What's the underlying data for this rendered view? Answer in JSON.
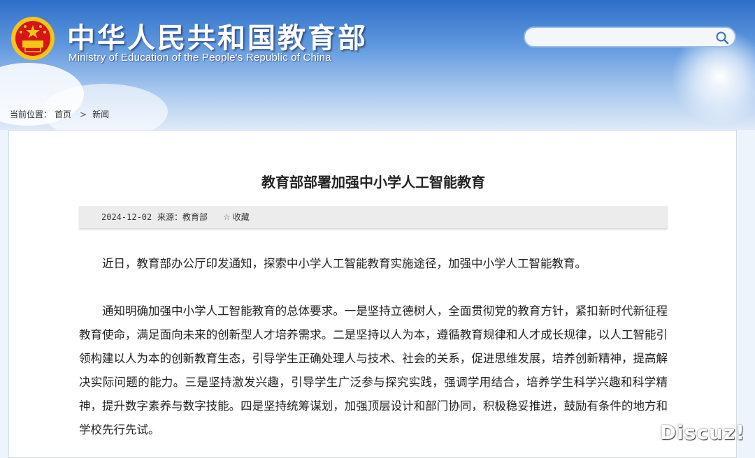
{
  "header": {
    "site_title": "中华人民共和国教育部",
    "site_subtitle": "Ministry of Education of the People's Republic of China",
    "search": {
      "value": ""
    },
    "colors": {
      "sky_top": "#2f6fc9",
      "emblem_red": "#d7141a",
      "emblem_gold": "#f5c518"
    }
  },
  "breadcrumb": {
    "label": "当前位置：",
    "items": [
      "首页",
      "新闻"
    ],
    "separator": ">"
  },
  "article": {
    "title": "教育部部署加强中小学人工智能教育",
    "date": "2024-12-02",
    "source": "来源：教育部",
    "favorite_label": "收藏",
    "paragraphs": [
      "近日，教育部办公厅印发通知，探索中小学人工智能教育实施途径，加强中小学人工智能教育。",
      "通知明确加强中小学人工智能教育的总体要求。一是坚持立德树人，全面贯彻党的教育方针，紧扣新时代新征程教育使命，满足面向未来的创新型人才培养需求。二是坚持以人为本，遵循教育规律和人才成长规律，以人工智能引领构建以人为本的创新教育生态，引导学生正确处理人与技术、社会的关系，促进思维发展，培养创新精神，提高解决实际问题的能力。三是坚持激发兴趣，引导学生广泛参与探究实践，强调学用结合，培养学生科学兴趣和科学精神，提升数字素养与数字技能。四是坚持统筹谋划，加强顶层设计和部门协同，积极稳妥推进，鼓励有条件的地方和学校先行先试。"
    ]
  },
  "watermark": "Discuz!"
}
